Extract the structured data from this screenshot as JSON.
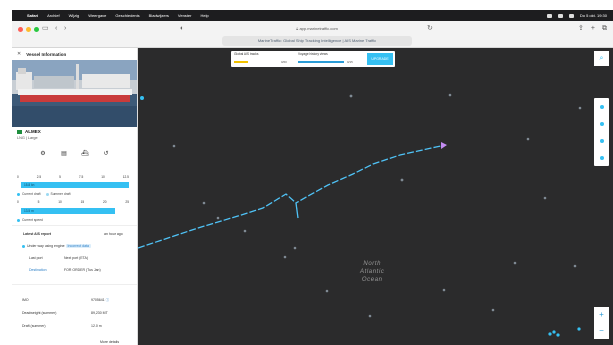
{
  "menubar": {
    "app": "Safari",
    "items": [
      "Archief",
      "Wijzig",
      "Weergave",
      "Geschiedenis",
      "Bladwijzers",
      "Venster",
      "Help"
    ],
    "clock": "Do 5 okt.  19:30"
  },
  "browser": {
    "url": "app.marinetraffic.com",
    "tab_title": "MarineTraffic: Global Ship Tracking Intelligence | AIS Marine Traffic"
  },
  "sidebar": {
    "title": "Vessel Information",
    "vessel_name": "ALMEX",
    "vessel_type": "LNG | Large",
    "scale_top": [
      "0",
      "2.5",
      "5",
      "7.5",
      "10",
      "12.5"
    ],
    "speed_bar": "15.8 kn",
    "legend_1": [
      "Current draft",
      "Summer draft"
    ],
    "scale_bottom": [
      "0",
      "5",
      "10",
      "15",
      "20",
      "25"
    ],
    "draft_bar": "13.5 m",
    "legend_2": "Current speed",
    "ais_label": "Latest AIS report",
    "ais_value": "an hour ago",
    "status": "Under way using engine",
    "status_badge": "Incorrect data",
    "last_port_label": "Last port",
    "last_port_value": "Next port (ETA)",
    "dest_label": "Destination",
    "dest_value": "FOR ORDER (Tus Jan)",
    "imo_label": "IMO",
    "imo_value": "9705641",
    "dwt_label": "Deadweight (summer)",
    "dwt_value": "89,230 MT",
    "draft_label": "Draft (summer)",
    "draft_value": "12.0 m",
    "more": "More details"
  },
  "map": {
    "overlay": {
      "label_1": "Global AIS tracks",
      "value_1": "0/60",
      "label_2": "Voyage history views",
      "value_2": "0/15",
      "button": "UPGRADE"
    },
    "ocean_label": [
      "North",
      "Atlantic",
      "Ocean"
    ],
    "zoom_in": "+",
    "zoom_out": "−"
  },
  "colors": {
    "accent": "#35c0f2",
    "map_bg": "#2b2b2c",
    "track": "#4fc3f7",
    "overlay_yellow": "#f2c200"
  }
}
